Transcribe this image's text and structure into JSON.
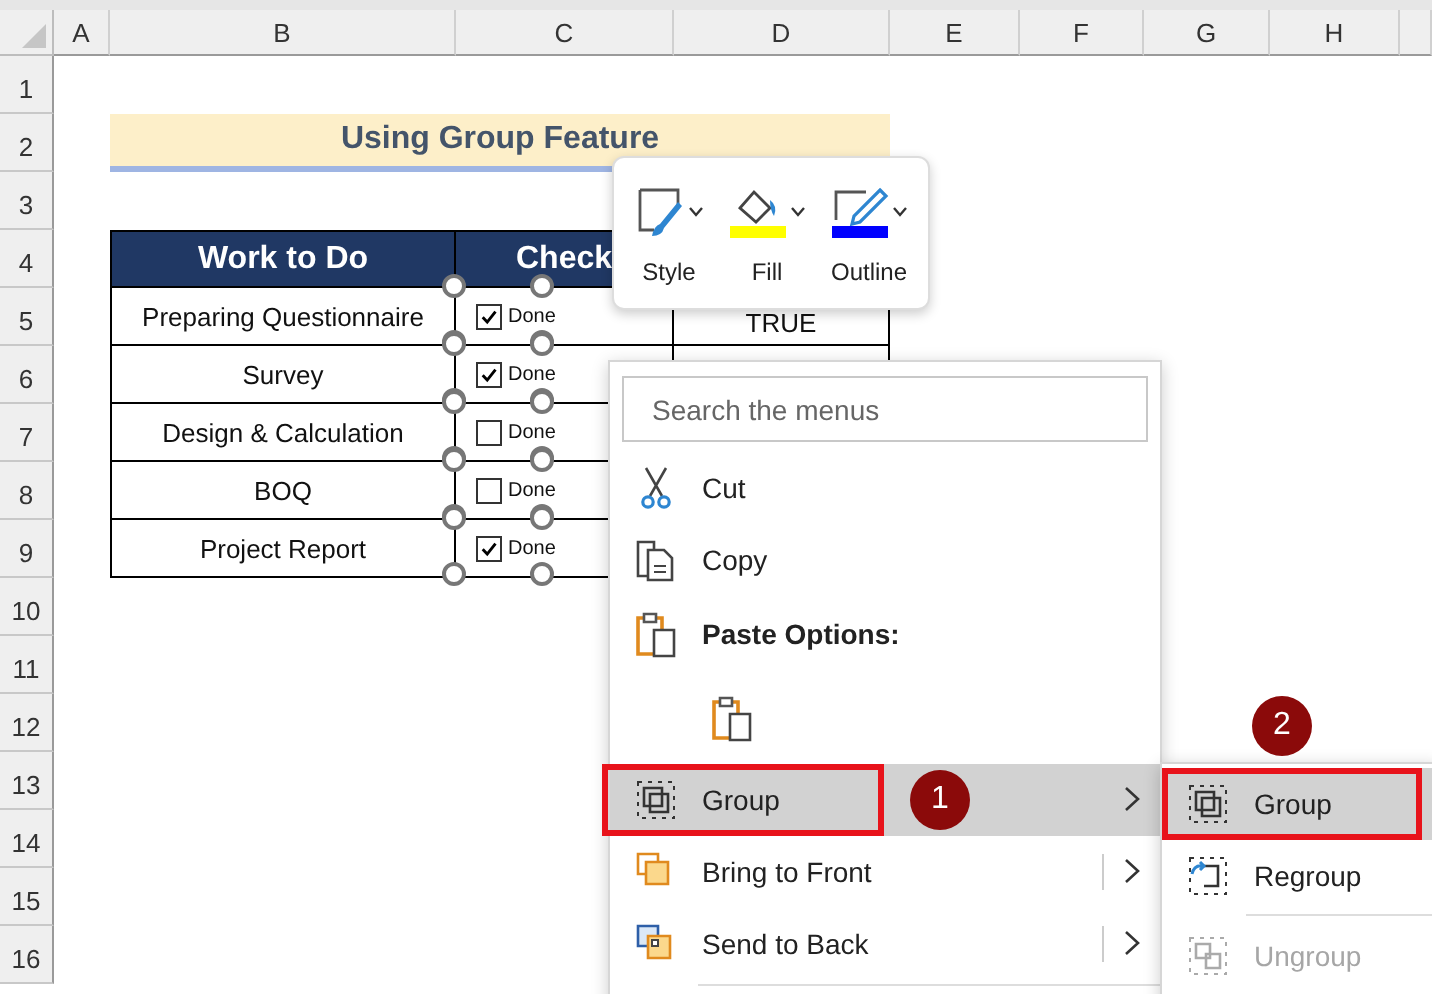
{
  "spreadsheet": {
    "columns": [
      "A",
      "B",
      "C",
      "D",
      "E",
      "F",
      "G",
      "H"
    ],
    "rows": [
      "1",
      "2",
      "3",
      "4",
      "5",
      "6",
      "7",
      "8",
      "9",
      "10",
      "11",
      "12",
      "13",
      "14",
      "15",
      "16"
    ]
  },
  "title": "Using Group Feature",
  "table": {
    "columns": [
      "Work to Do",
      "Check"
    ],
    "rows": [
      {
        "task": "Preparing Questionnaire",
        "checkbox_label": "Done",
        "checked": true,
        "result": "TRUE"
      },
      {
        "task": "Survey",
        "checkbox_label": "Done",
        "checked": true
      },
      {
        "task": "Design & Calculation",
        "checkbox_label": "Done",
        "checked": false
      },
      {
        "task": "BOQ",
        "checkbox_label": "Done",
        "checked": false
      },
      {
        "task": "Project Report",
        "checkbox_label": "Done",
        "checked": true
      }
    ]
  },
  "mini_toolbar": [
    {
      "kind": "style",
      "label": "Style"
    },
    {
      "kind": "fill",
      "label": "Fill",
      "color": "#ffff00"
    },
    {
      "kind": "outline",
      "label": "Outline",
      "color": "#0000ff"
    }
  ],
  "context_menu": {
    "search": {
      "placeholder": "Search the menus"
    },
    "items": [
      {
        "kind": "cut",
        "label": "Cut",
        "selected": false
      },
      {
        "kind": "copy",
        "label": "Copy",
        "selected": false
      },
      {
        "kind": "paste-heading",
        "label": "Paste Options:",
        "selected": false
      },
      {
        "kind": "paste-button",
        "selected": false
      },
      {
        "kind": "group",
        "label": "Group",
        "selected": true,
        "submenu": true,
        "callout": "1"
      },
      {
        "kind": "bring-front",
        "label": "Bring to Front",
        "selected": false,
        "submenu": true,
        "split": true
      },
      {
        "kind": "send-back",
        "label": "Send to Back",
        "selected": false,
        "submenu": true,
        "split": true
      }
    ]
  },
  "submenu": {
    "items": [
      {
        "kind": "group",
        "label": "Group",
        "selected": true,
        "disabled": false,
        "callout": "2"
      },
      {
        "kind": "regroup",
        "label": "Regroup",
        "selected": false,
        "disabled": false
      },
      {
        "kind": "ungroup",
        "label": "Ungroup",
        "selected": false,
        "disabled": true
      }
    ]
  }
}
